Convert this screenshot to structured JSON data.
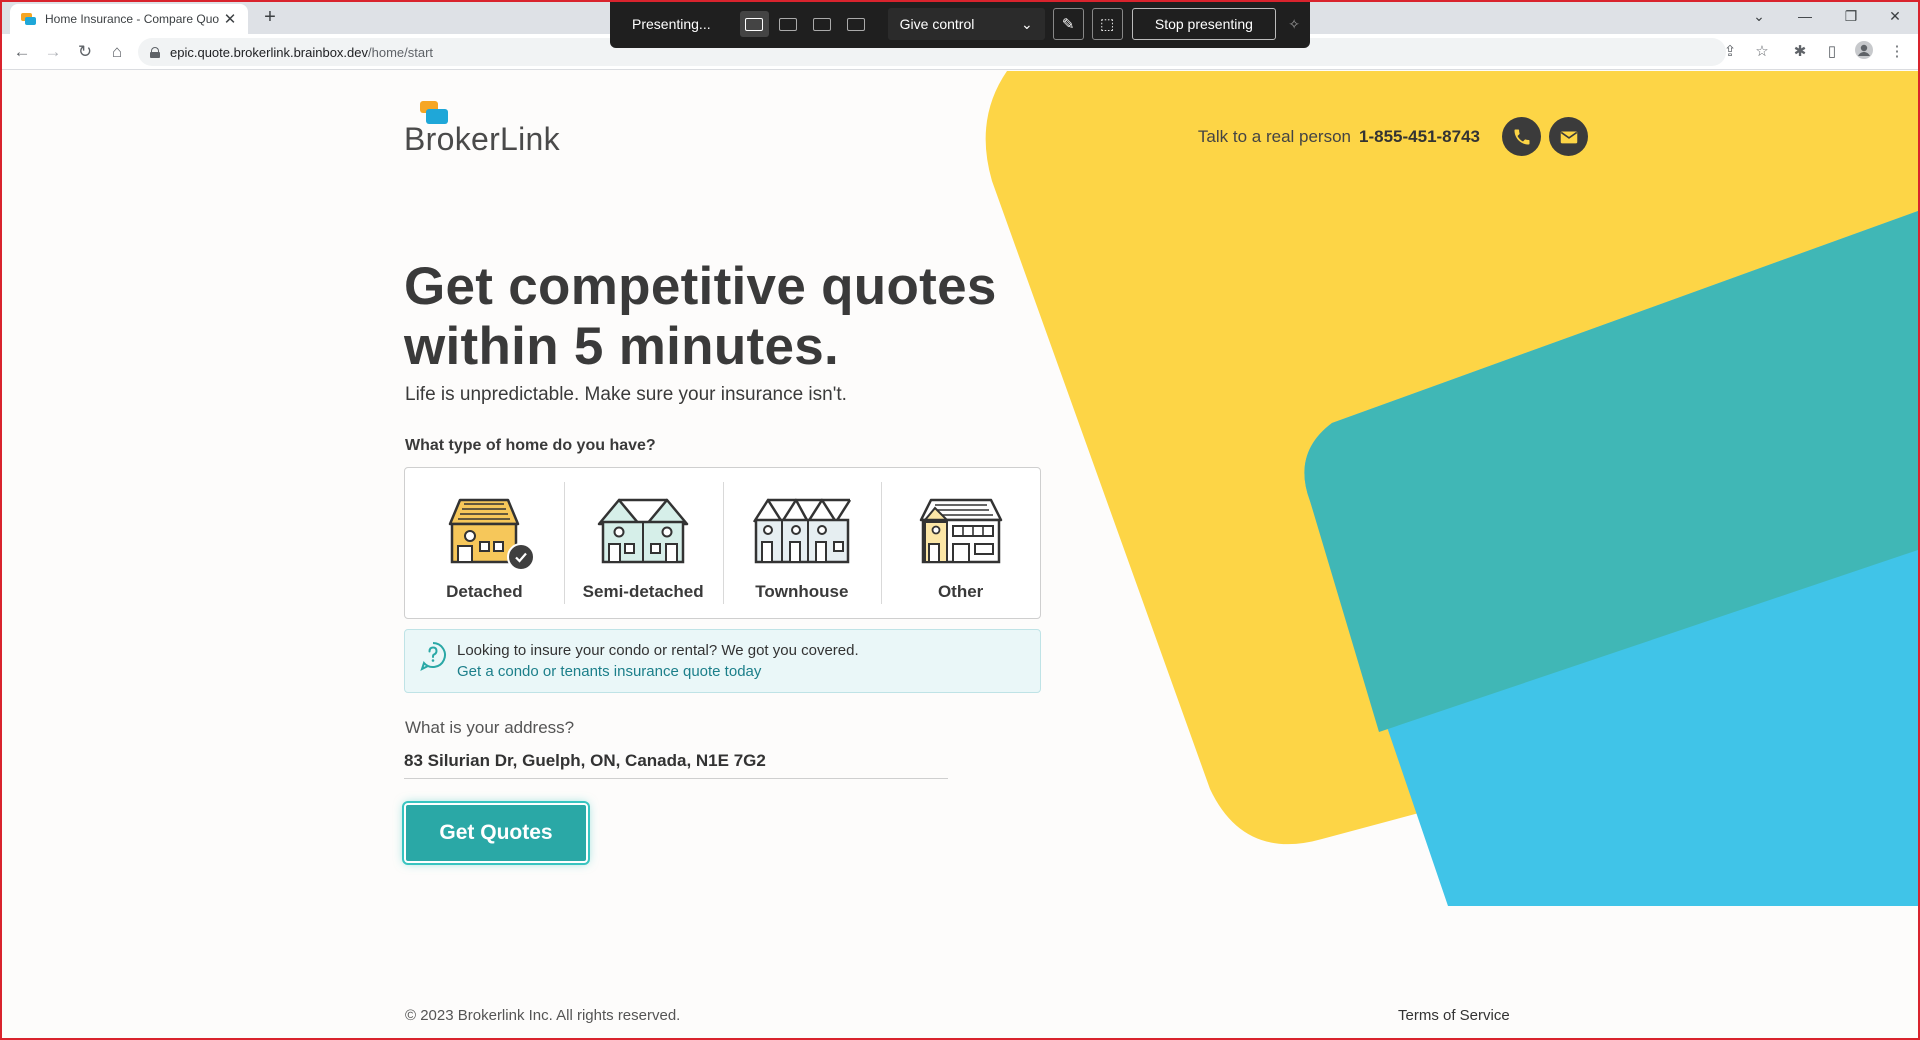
{
  "browser": {
    "tab_title": "Home Insurance - Compare Quo",
    "tab_close": "✕",
    "new_tab": "+",
    "url_host": "epic.quote.brokerlink.brainbox.dev",
    "url_path": "/home/start",
    "window_controls": [
      "⌄",
      "—",
      "❐",
      "✕"
    ]
  },
  "present_bar": {
    "status": "Presenting...",
    "give_control": "Give control",
    "stop": "Stop presenting"
  },
  "site": {
    "logo_text": "BrokerLink",
    "contact_label": "Talk to a real person",
    "phone": "1-855-451-8743"
  },
  "hero": {
    "line1": "Get competitive quotes",
    "line2": "within 5 minutes.",
    "subhead": "Life is unpredictable. Make sure your insurance isn't."
  },
  "form": {
    "home_question": "What type of home do you have?",
    "home_types": [
      {
        "label": "Detached",
        "selected": true
      },
      {
        "label": "Semi-detached",
        "selected": false
      },
      {
        "label": "Townhouse",
        "selected": false
      },
      {
        "label": "Other",
        "selected": false
      }
    ],
    "notice_text": "Looking to insure your condo or rental? We got you covered.",
    "notice_link": "Get a condo or tenants insurance quote today",
    "address_question": "What is your address?",
    "address_value": "83 Silurian Dr, Guelph, ON, Canada, N1E 7G2",
    "submit": "Get Quotes"
  },
  "footer": {
    "copyright": "© 2023 Brokerlink Inc. All rights reserved.",
    "terms": "Terms of Service"
  },
  "colors": {
    "brand_teal": "#2aa8a6",
    "yellow": "#fdd546",
    "teal_shape": "#40b7b6",
    "blue_shape": "#40c4e8"
  }
}
